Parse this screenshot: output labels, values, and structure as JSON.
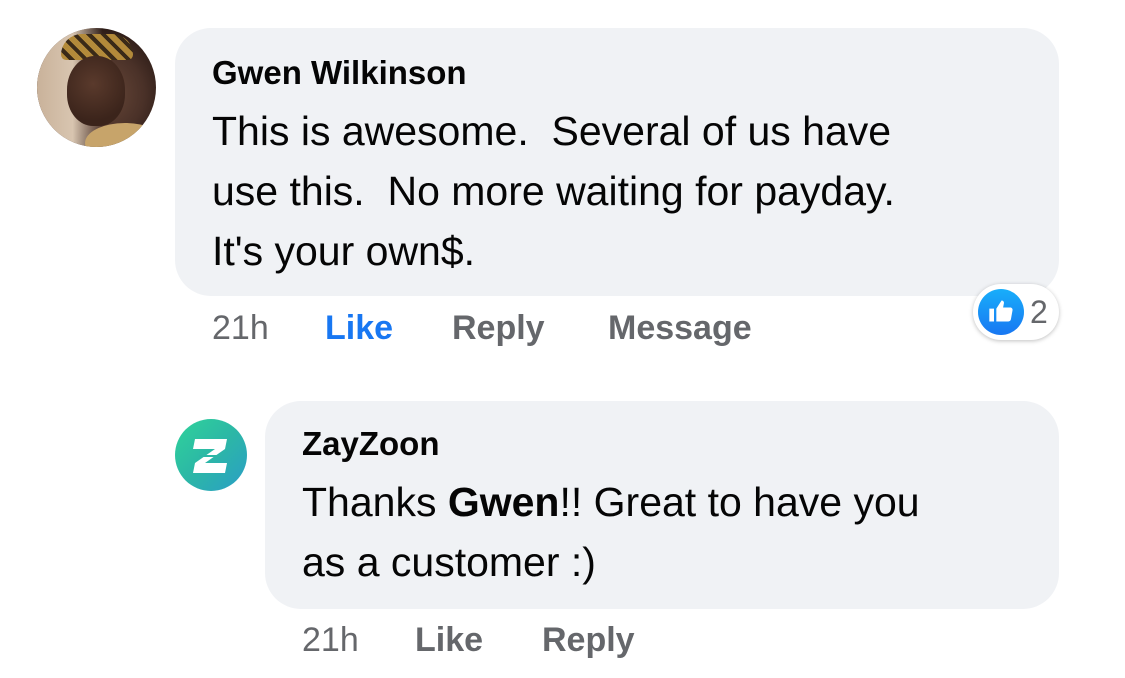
{
  "comments": [
    {
      "author": "Gwen Wilkinson",
      "text_lines": [
        "This is awesome.  Several of us have",
        "use this.  No more waiting for payday.",
        "It's your own$."
      ],
      "time": "21h",
      "actions": {
        "like": "Like",
        "reply": "Reply",
        "message": "Message"
      },
      "like_state": "liked",
      "reaction": {
        "icon": "thumbs-up-icon",
        "count": "2",
        "color": "#1877f2"
      }
    },
    {
      "author": "ZayZoon",
      "text": {
        "line1_prefix": "Thanks ",
        "line1_mention": "Gwen",
        "line1_suffix": "!! Great to have you",
        "line2": "as a customer :)"
      },
      "time": "21h",
      "actions": {
        "like": "Like",
        "reply": "Reply"
      }
    }
  ],
  "colors": {
    "bubble": "#f0f2f5",
    "secondary_text": "#65676b",
    "accent": "#1877f2",
    "zayzoon_gradient": [
      "#2fd39a",
      "#2a9ec7"
    ]
  }
}
